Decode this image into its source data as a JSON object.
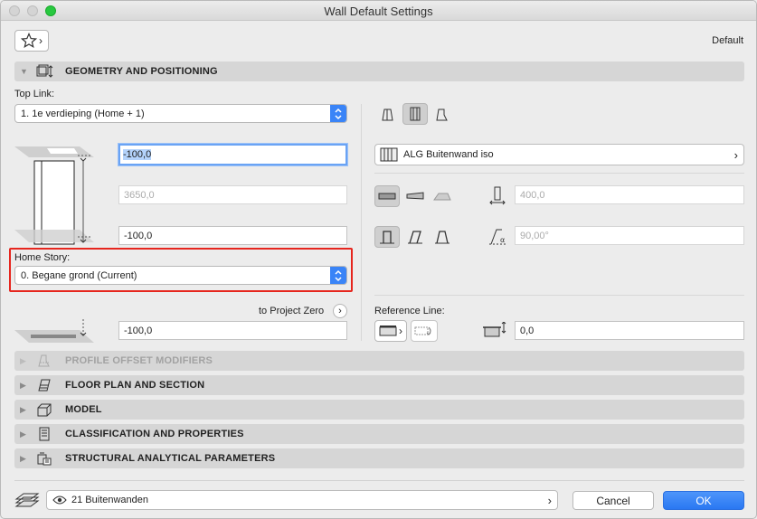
{
  "window": {
    "title": "Wall Default Settings"
  },
  "header": {
    "favorites_chevron": "›",
    "default_label": "Default"
  },
  "sections": {
    "geometry": "GEOMETRY AND POSITIONING",
    "profile": "PROFILE OFFSET MODIFIERS",
    "floor_plan": "FLOOR PLAN AND SECTION",
    "model": "MODEL",
    "classification": "CLASSIFICATION AND PROPERTIES",
    "structural": "STRUCTURAL ANALYTICAL PARAMETERS"
  },
  "geometry": {
    "top_link_label": "Top Link:",
    "top_link_value": "1. 1e verdieping (Home + 1)",
    "top_offset": "-100,0",
    "height": "3650,0",
    "bottom_offset": "-100,0",
    "home_story_label": "Home Story:",
    "home_story_value": "0. Begane grond (Current)",
    "to_project_zero_label": "to Project Zero",
    "project_zero_value": "-100,0",
    "composite_name": "ALG Buitenwand iso",
    "thickness": "400,0",
    "slant_angle": "90,00°",
    "reference_line_label": "Reference Line:",
    "reference_offset": "0,0"
  },
  "footer": {
    "layer": "21 Buitenwanden",
    "cancel_label": "Cancel",
    "ok_label": "OK"
  },
  "colors": {
    "accent": "#3a84f7",
    "highlight": "#e6261e"
  }
}
